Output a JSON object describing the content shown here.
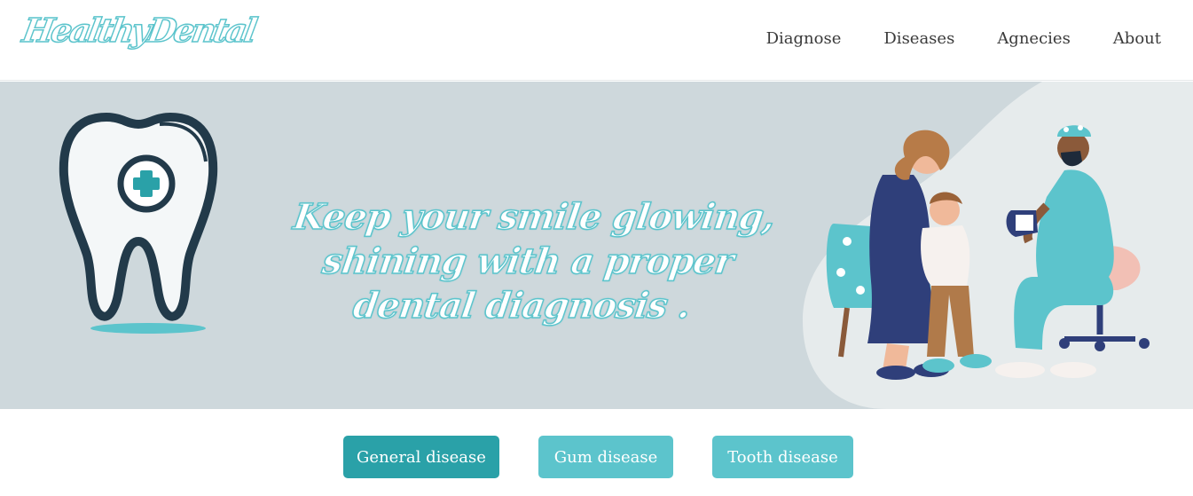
{
  "header": {
    "logo_text": "HealthyDental",
    "nav": [
      {
        "label": "Diagnose"
      },
      {
        "label": "Diseases"
      },
      {
        "label": "Agnecies"
      },
      {
        "label": "About"
      }
    ]
  },
  "hero": {
    "tagline_line1": "Keep your smile glowing,",
    "tagline_line2": "shining with  a proper",
    "tagline_line3": "dental diagnosis .",
    "tooth_icon": "tooth-with-plus-icon",
    "illustration": "dentist-with-mother-and-child-illustration"
  },
  "categories": [
    {
      "label": "General disease"
    },
    {
      "label": "Gum disease"
    },
    {
      "label": "Tooth disease"
    }
  ],
  "colors": {
    "accent": "#5cc4cc",
    "accent_dark": "#2aa1a8",
    "hero_bg": "#ced8dc",
    "nav_text": "#3a3a3a"
  }
}
